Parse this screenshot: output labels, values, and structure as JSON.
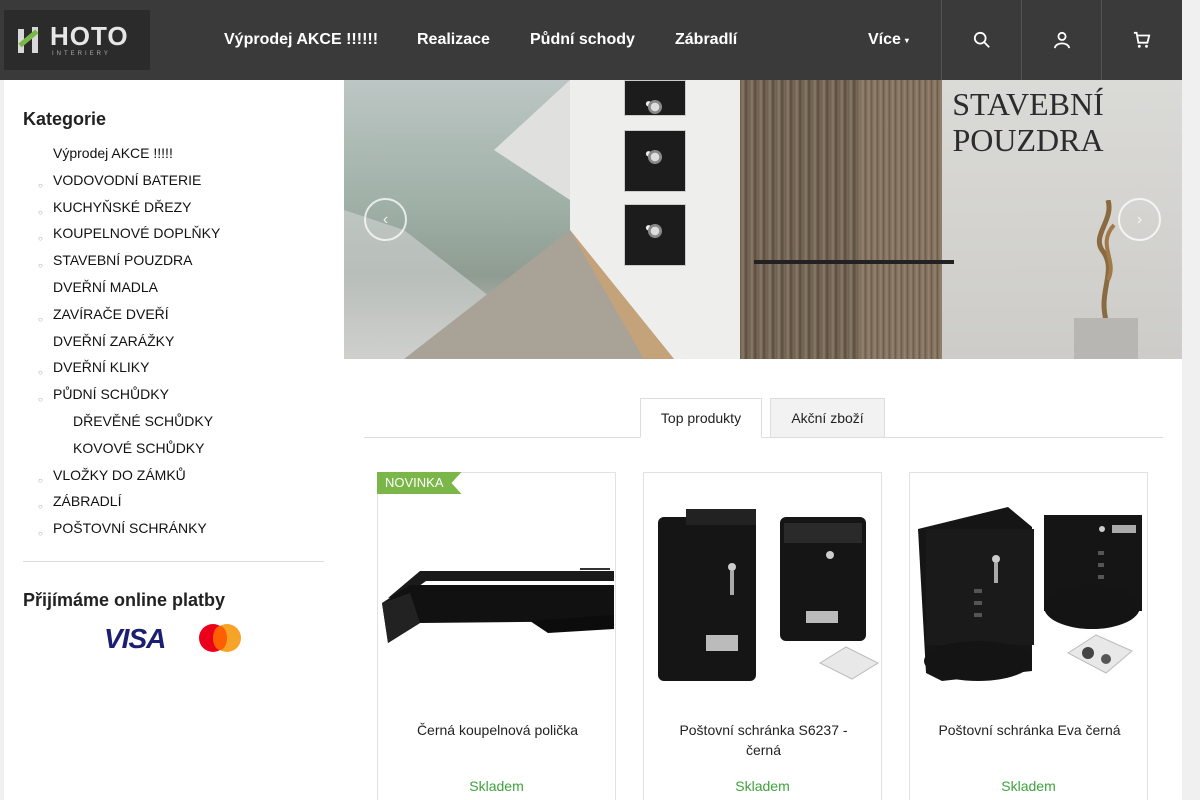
{
  "header": {
    "logo_text": "HOTO",
    "logo_sub": "INTERIERY",
    "nav": [
      {
        "label": "Výprodej AKCE !!!!!!"
      },
      {
        "label": "Realizace"
      },
      {
        "label": "Půdní schody"
      },
      {
        "label": "Zábradlí"
      },
      {
        "label": "Více"
      }
    ],
    "buttons": [
      {
        "icon": "search-icon"
      },
      {
        "icon": "user-icon"
      },
      {
        "icon": "cart-icon"
      }
    ]
  },
  "sidebar": {
    "title": "Kategorie",
    "items": [
      {
        "label": "Výprodej AKCE !!!!!",
        "bullet": false,
        "sub": false
      },
      {
        "label": "VODOVODNÍ BATERIE",
        "bullet": true,
        "sub": false
      },
      {
        "label": "KUCHYŇSKÉ DŘEZY",
        "bullet": true,
        "sub": false
      },
      {
        "label": "KOUPELNOVÉ DOPLŇKY",
        "bullet": true,
        "sub": false
      },
      {
        "label": "STAVEBNÍ POUZDRA",
        "bullet": true,
        "sub": false
      },
      {
        "label": "DVEŘNÍ MADLA",
        "bullet": false,
        "sub": false
      },
      {
        "label": "ZAVÍRAČE DVEŘÍ",
        "bullet": true,
        "sub": false
      },
      {
        "label": "DVEŘNÍ ZARÁŽKY",
        "bullet": false,
        "sub": false
      },
      {
        "label": "DVEŘNÍ KLIKY",
        "bullet": true,
        "sub": false
      },
      {
        "label": "PŮDNÍ SCHŮDKY",
        "bullet": true,
        "sub": false
      },
      {
        "label": "DŘEVĚNÉ SCHŮDKY",
        "bullet": false,
        "sub": true
      },
      {
        "label": "KOVOVÉ SCHŮDKY",
        "bullet": false,
        "sub": true
      },
      {
        "label": "VLOŽKY DO ZÁMKŮ",
        "bullet": true,
        "sub": false
      },
      {
        "label": "ZÁBRADLÍ",
        "bullet": true,
        "sub": false
      },
      {
        "label": "POŠTOVNÍ SCHRÁNKY",
        "bullet": true,
        "sub": false
      }
    ],
    "payments_title": "Přijímáme online platby",
    "visa_label": "VISA"
  },
  "banner": {
    "text_line1": "STAVEBNÍ",
    "text_line2": "POUZDRA"
  },
  "tabs": [
    {
      "label": "Top produkty",
      "active": true
    },
    {
      "label": "Akční zboží",
      "active": false
    }
  ],
  "products": [
    {
      "name": "Černá koupelnová polička",
      "stock": "Skladem",
      "badge": "NOVINKA"
    },
    {
      "name": "Poštovní schránka S6237 - černá",
      "stock": "Skladem",
      "badge": ""
    },
    {
      "name": "Poštovní schránka Eva černá",
      "stock": "Skladem",
      "badge": ""
    }
  ],
  "colors": {
    "header_bg": "#3a3a3a",
    "accent_green": "#7ab648",
    "stock_green": "#3ea33e"
  }
}
